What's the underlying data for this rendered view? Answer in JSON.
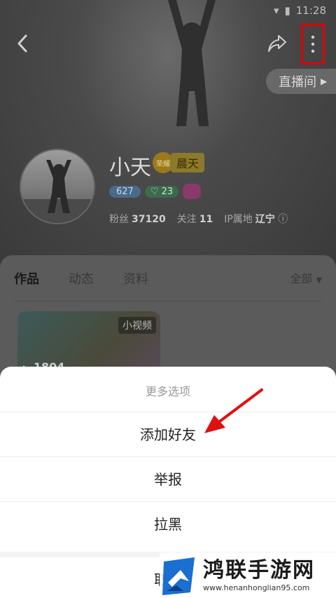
{
  "status_bar": {
    "time": "11:28"
  },
  "header": {
    "back_icon": "chevron-left-icon",
    "share_icon": "share-arrow-icon",
    "more_icon": "vertical-ellipsis-icon",
    "live_room_label": "直播间"
  },
  "profile": {
    "name": "小天",
    "rank_label": "晨天",
    "rank_emblem_text": "荣耀",
    "badge_level": "627",
    "badge_heart_count": "23",
    "fans_label": "粉丝",
    "fans_count": "37120",
    "following_label": "关注",
    "following_count": "11",
    "ip_label": "IP属地",
    "ip_location": "辽宁"
  },
  "tabs": {
    "items": [
      {
        "label": "作品",
        "active": true
      },
      {
        "label": "动态",
        "active": false
      },
      {
        "label": "资料",
        "active": false
      }
    ],
    "filter_label": "全部"
  },
  "video": {
    "tag": "小视频",
    "views": "1804"
  },
  "sheet": {
    "title": "更多选项",
    "add_friend": "添加好友",
    "report": "举报",
    "block": "拉黑",
    "cancel": "取消"
  },
  "watermark": {
    "title": "鸿联手游网",
    "url": "www.henanhonglian95.com"
  },
  "colors": {
    "highlight_box": "#e00000",
    "arrow": "#e01010"
  }
}
